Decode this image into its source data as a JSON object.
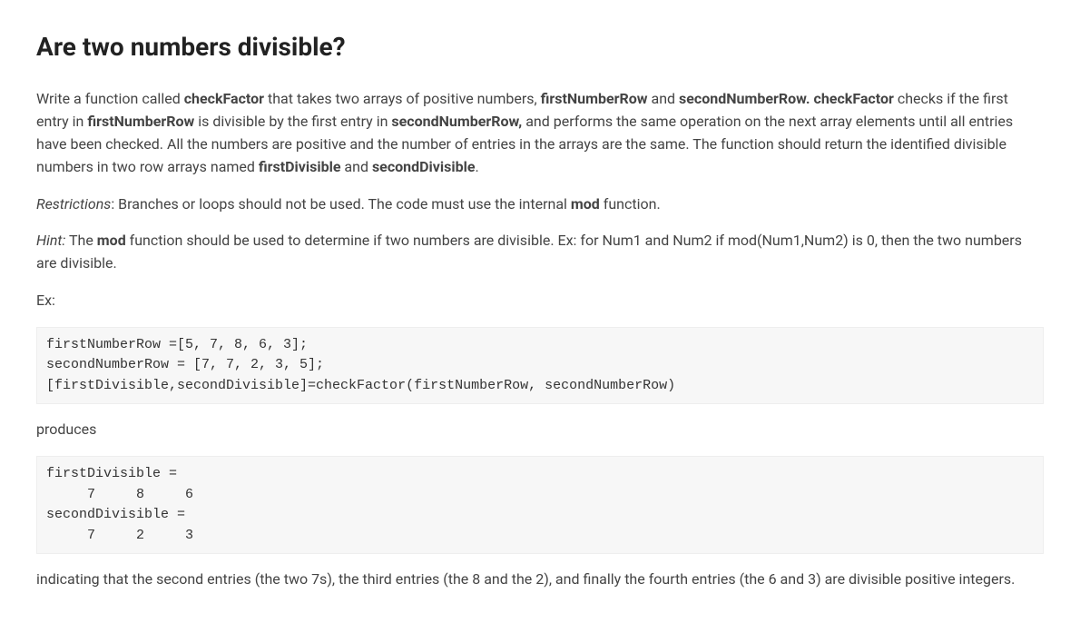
{
  "title": "Are two numbers divisible?",
  "p1": {
    "t1": "Write a function called ",
    "b1": "checkFactor",
    "t2": " that takes two arrays of positive numbers, ",
    "b2": "firstNumberRow",
    "t3": " and ",
    "b3": "secondNumberRow. checkFactor",
    "t4": " checks if the first entry in ",
    "b4": "firstNumberRow",
    "t5": " is divisible by the first entry in ",
    "b5": "secondNumberRow,",
    "t6": " and performs the same operation on the next array elements until all entries have been checked.  All the numbers are positive and the number of entries in the arrays are the same. The function should return the identified divisible numbers in two row arrays named ",
    "b6": "firstDivisible",
    "t7": " and ",
    "b7": "secondDivisible",
    "t8": "."
  },
  "p2": {
    "i1": "Restrictions",
    "t1": ": Branches or loops should not be used.  The code must use the internal ",
    "b1": "mod",
    "t2": " function."
  },
  "p3": {
    "i1": "Hint:",
    "t1": "  The ",
    "b1": "mod",
    "t2": " function should be used to determine if two numbers are divisible. Ex: for Num1 and Num2 if mod(Num1,Num2) is 0, then the two numbers are divisible."
  },
  "exLabel": "Ex:",
  "code1": "firstNumberRow =[5, 7, 8, 6, 3];\nsecondNumberRow = [7, 7, 2, 3, 5];\n[firstDivisible,secondDivisible]=checkFactor(firstNumberRow, secondNumberRow)",
  "producesLabel": "produces",
  "code2": "firstDivisible =\n     7     8     6\nsecondDivisible =\n     7     2     3",
  "p4": "indicating that the second entries (the two 7s), the third entries (the 8 and the 2), and finally the fourth entries (the 6 and 3) are divisible positive integers."
}
